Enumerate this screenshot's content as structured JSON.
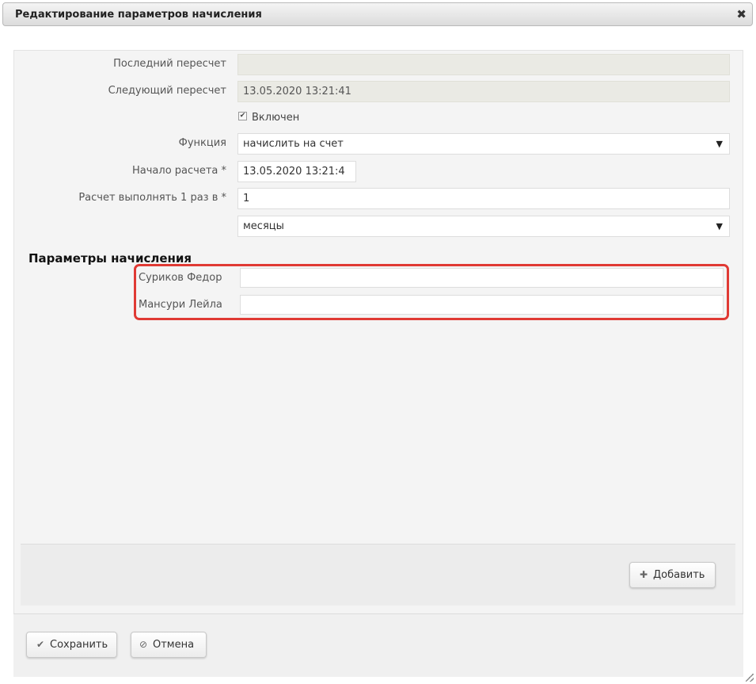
{
  "dialog": {
    "title": "Редактирование параметров начисления",
    "close_icon": "close-icon"
  },
  "form": {
    "last_recalc": {
      "label": "Последний пересчет",
      "value": ""
    },
    "next_recalc": {
      "label": "Следующий пересчет",
      "value": "13.05.2020 13:21:41"
    },
    "enabled": {
      "label": "Включен",
      "checked": true
    },
    "function": {
      "label": "Функция",
      "value": "начислить на счет"
    },
    "start": {
      "label": "Начало расчета *",
      "value": "13.05.2020 13:21:4"
    },
    "frequency": {
      "label": "Расчет выполнять 1 раз в *",
      "value": "1"
    },
    "period": {
      "value": "месяцы"
    }
  },
  "params": {
    "title": "Параметры начисления",
    "rows": [
      {
        "label": "Суриков Федор",
        "value": ""
      },
      {
        "label": "Мансури Лейла",
        "value": ""
      }
    ],
    "highlight_color": "#e03a34"
  },
  "actions": {
    "add_label": "Добавить",
    "save_label": "Сохранить",
    "cancel_label": "Отмена"
  }
}
